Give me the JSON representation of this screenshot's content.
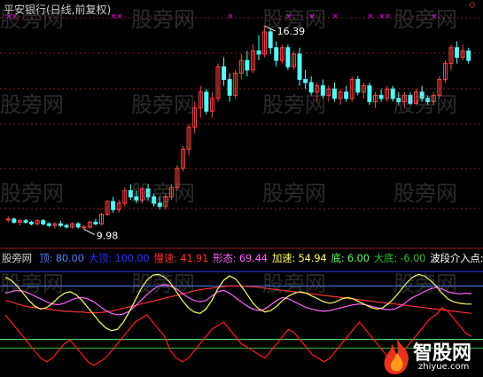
{
  "title": "平安银行(日线,前复权)",
  "colors": {
    "bg": "#000000",
    "up": "#ff4444",
    "down": "#54ffff",
    "grid": "#8b1c1c",
    "pink": "#ff00ff",
    "white": "#ffffff"
  },
  "watermark_text": "股旁网",
  "logo": {
    "brand": "智股网",
    "url": "zhiyue.com",
    "icon": "flame-icon"
  },
  "indicator": {
    "name": "股旁网",
    "items": [
      {
        "label": "顶: 80.00",
        "color": "#4a7dff"
      },
      {
        "label": "大顶: 100.00",
        "color": "#3030ff"
      },
      {
        "label": "慢速: 41.91",
        "color": "#ff3030"
      },
      {
        "label": "形态: 69.44",
        "color": "#ff60ff"
      },
      {
        "label": "加速: 54.94",
        "color": "#ffff60"
      },
      {
        "label": "底: 6.00",
        "color": "#60ff60"
      },
      {
        "label": "大底: -6.00",
        "color": "#30c030"
      },
      {
        "label": "波段介入点:",
        "color": "#ffffff"
      }
    ]
  },
  "chart_data": [
    {
      "type": "candlestick",
      "title": "平安银行(日线,前复权)",
      "annotations": [
        {
          "label": "16.39",
          "value": 16.39
        },
        {
          "label": "9.98",
          "value": 9.98
        }
      ],
      "ohlc": [
        [
          10.3,
          10.4,
          10.2,
          10.3
        ],
        [
          10.3,
          10.35,
          10.15,
          10.2
        ],
        [
          10.2,
          10.3,
          10.1,
          10.25
        ],
        [
          10.25,
          10.3,
          10.15,
          10.2
        ],
        [
          10.2,
          10.25,
          10.1,
          10.15
        ],
        [
          10.15,
          10.3,
          10.1,
          10.25
        ],
        [
          10.25,
          10.3,
          10.1,
          10.15
        ],
        [
          10.15,
          10.2,
          10.05,
          10.1
        ],
        [
          10.1,
          10.2,
          10.0,
          10.15
        ],
        [
          10.15,
          10.25,
          10.05,
          10.1
        ],
        [
          10.1,
          10.15,
          10.0,
          10.05
        ],
        [
          10.05,
          10.2,
          10.0,
          10.15
        ],
        [
          10.15,
          10.2,
          10.0,
          10.05
        ],
        [
          10.05,
          10.1,
          9.98,
          10.05
        ],
        [
          10.05,
          10.25,
          10.0,
          10.2
        ],
        [
          10.2,
          10.3,
          10.1,
          10.15
        ],
        [
          10.15,
          10.5,
          10.1,
          10.45
        ],
        [
          10.45,
          10.9,
          10.4,
          10.85
        ],
        [
          10.85,
          11.0,
          10.5,
          10.6
        ],
        [
          10.6,
          10.9,
          10.5,
          10.8
        ],
        [
          10.8,
          11.3,
          10.7,
          11.2
        ],
        [
          11.2,
          11.4,
          10.9,
          11.0
        ],
        [
          11.0,
          11.2,
          10.8,
          10.9
        ],
        [
          10.9,
          11.3,
          10.8,
          11.25
        ],
        [
          11.25,
          11.4,
          10.9,
          11.0
        ],
        [
          11.0,
          11.1,
          10.7,
          10.8
        ],
        [
          10.8,
          11.0,
          10.6,
          10.7
        ],
        [
          10.7,
          11.1,
          10.6,
          11.0
        ],
        [
          11.0,
          11.4,
          10.9,
          11.3
        ],
        [
          11.3,
          12.0,
          11.2,
          11.9
        ],
        [
          11.9,
          12.6,
          11.8,
          12.5
        ],
        [
          12.5,
          13.3,
          12.3,
          13.2
        ],
        [
          13.2,
          14.0,
          13.0,
          13.8
        ],
        [
          13.8,
          14.5,
          13.5,
          14.3
        ],
        [
          14.3,
          14.4,
          13.6,
          13.7
        ],
        [
          13.7,
          14.3,
          13.5,
          14.1
        ],
        [
          14.1,
          15.2,
          14.0,
          15.1
        ],
        [
          15.1,
          15.4,
          14.5,
          14.7
        ],
        [
          14.7,
          14.9,
          14.0,
          14.2
        ],
        [
          14.2,
          15.0,
          14.1,
          14.9
        ],
        [
          14.9,
          15.5,
          14.7,
          15.3
        ],
        [
          15.3,
          15.6,
          14.8,
          15.0
        ],
        [
          15.0,
          15.8,
          14.9,
          15.6
        ],
        [
          15.6,
          16.1,
          15.3,
          15.5
        ],
        [
          15.5,
          16.39,
          15.4,
          16.2
        ],
        [
          16.2,
          16.3,
          15.5,
          15.7
        ],
        [
          15.7,
          15.9,
          15.1,
          15.3
        ],
        [
          15.3,
          15.8,
          15.2,
          15.7
        ],
        [
          15.7,
          15.8,
          15.0,
          15.1
        ],
        [
          15.1,
          15.6,
          15.0,
          15.5
        ],
        [
          15.5,
          15.7,
          14.5,
          14.7
        ],
        [
          14.7,
          15.0,
          14.4,
          14.6
        ],
        [
          14.6,
          14.8,
          14.2,
          14.3
        ],
        [
          14.3,
          14.6,
          14.0,
          14.5
        ],
        [
          14.5,
          14.7,
          14.1,
          14.2
        ],
        [
          14.2,
          14.5,
          14.0,
          14.4
        ],
        [
          14.4,
          14.6,
          14.0,
          14.1
        ],
        [
          14.1,
          14.4,
          13.9,
          14.3
        ],
        [
          14.3,
          14.5,
          14.0,
          14.1
        ],
        [
          14.1,
          14.8,
          14.0,
          14.7
        ],
        [
          14.7,
          14.8,
          14.2,
          14.3
        ],
        [
          14.3,
          14.6,
          14.1,
          14.5
        ],
        [
          14.5,
          14.6,
          13.9,
          14.0
        ],
        [
          14.0,
          14.3,
          13.8,
          14.2
        ],
        [
          14.2,
          14.4,
          14.0,
          14.1
        ],
        [
          14.1,
          14.5,
          14.0,
          14.4
        ],
        [
          14.4,
          14.5,
          14.0,
          14.1
        ],
        [
          14.1,
          14.3,
          13.9,
          14.0
        ],
        [
          14.0,
          14.3,
          13.8,
          14.2
        ],
        [
          14.2,
          14.3,
          13.9,
          13.95
        ],
        [
          13.95,
          14.4,
          13.9,
          14.3
        ],
        [
          14.3,
          14.5,
          14.0,
          14.1
        ],
        [
          14.1,
          14.2,
          13.9,
          14.0
        ],
        [
          14.0,
          14.3,
          13.9,
          14.2
        ],
        [
          14.2,
          14.8,
          14.1,
          14.7
        ],
        [
          14.7,
          15.3,
          14.6,
          15.2
        ],
        [
          15.2,
          15.8,
          15.0,
          15.7
        ],
        [
          15.7,
          15.9,
          15.2,
          15.4
        ],
        [
          15.4,
          15.8,
          15.3,
          15.6
        ],
        [
          15.6,
          15.7,
          15.2,
          15.3
        ]
      ]
    },
    {
      "type": "line",
      "title": "股旁网",
      "series": [
        {
          "name": "顶",
          "values": [
            80
          ],
          "color": "#4a7dff"
        },
        {
          "name": "大顶",
          "values": [
            100
          ],
          "color": "#3030ff"
        },
        {
          "name": "慢速",
          "values": [
            60,
            58,
            55,
            53,
            51,
            50,
            49,
            48,
            47,
            46,
            45,
            45,
            44,
            44,
            43,
            43,
            43,
            44,
            45,
            47,
            49,
            51,
            53,
            55,
            57,
            59,
            61,
            63,
            65,
            67,
            69,
            71,
            73,
            75,
            76,
            77,
            78,
            79,
            80,
            80,
            80,
            79,
            79,
            78,
            77,
            76,
            75,
            74,
            73,
            72,
            71,
            70,
            69,
            68,
            67,
            66,
            65,
            64,
            63,
            62,
            61,
            60,
            59,
            58,
            57,
            56,
            55,
            54,
            53,
            52,
            51,
            50,
            49,
            48,
            47,
            46,
            45,
            44,
            43,
            42
          ],
          "color": "#ff3030"
        },
        {
          "name": "形态",
          "values": [
            70,
            72,
            74,
            73,
            70,
            66,
            62,
            58,
            55,
            54,
            56,
            60,
            63,
            64,
            62,
            58,
            52,
            46,
            42,
            40,
            41,
            45,
            52,
            60,
            68,
            75,
            80,
            82,
            80,
            76,
            70,
            64,
            60,
            58,
            60,
            66,
            72,
            74,
            70,
            64,
            58,
            52,
            48,
            46,
            48,
            54,
            60,
            64,
            62,
            58,
            54,
            50,
            48,
            46,
            45,
            46,
            48,
            50,
            52,
            54,
            55,
            54,
            52,
            50,
            48,
            47,
            48,
            52,
            58,
            64,
            68,
            72,
            76,
            78,
            76,
            72,
            70,
            69,
            70,
            69.44
          ],
          "color": "#ff60ff"
        },
        {
          "name": "加速",
          "values": [
            92,
            88,
            80,
            70,
            60,
            52,
            48,
            50,
            56,
            64,
            70,
            72,
            68,
            60,
            50,
            40,
            30,
            22,
            18,
            20,
            30,
            44,
            60,
            76,
            88,
            95,
            96,
            92,
            84,
            72,
            60,
            50,
            44,
            42,
            48,
            60,
            76,
            88,
            94,
            90,
            80,
            68,
            56,
            48,
            44,
            46,
            52,
            60,
            66,
            70,
            72,
            70,
            66,
            62,
            58,
            56,
            58,
            62,
            64,
            62,
            58,
            54,
            50,
            48,
            50,
            56,
            64,
            74,
            84,
            92,
            96,
            94,
            88,
            80,
            70,
            62,
            58,
            56,
            55,
            54.94
          ],
          "color": "#ffff60"
        },
        {
          "name": "底",
          "values": [
            6
          ],
          "color": "#60ff60"
        },
        {
          "name": "大底",
          "values": [
            -6
          ],
          "color": "#30c030"
        },
        {
          "name": "波段介入点",
          "values": [
            40,
            30,
            20,
            10,
            0,
            -10,
            -20,
            -25,
            -20,
            -10,
            0,
            5,
            -5,
            -15,
            -25,
            -30,
            -25,
            -20,
            -10,
            0,
            10,
            20,
            30,
            35,
            40,
            30,
            20,
            10,
            -10,
            -20,
            -25,
            -20,
            -10,
            0,
            10,
            20,
            25,
            30,
            20,
            10,
            0,
            -5,
            -10,
            -15,
            -20,
            -10,
            0,
            10,
            20,
            15,
            5,
            -5,
            -15,
            -20,
            -25,
            -20,
            -10,
            0,
            10,
            20,
            30,
            20,
            10,
            0,
            -10,
            -20,
            -25,
            -15,
            -5,
            5,
            15,
            25,
            35,
            40,
            50,
            45,
            35,
            25,
            15,
            10
          ],
          "color": "#ff2020"
        }
      ]
    }
  ]
}
